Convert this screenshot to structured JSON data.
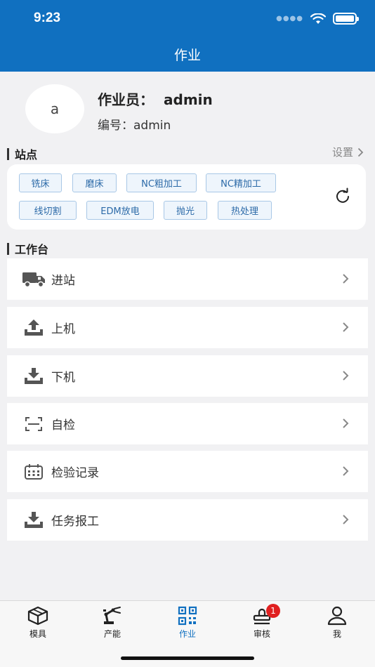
{
  "status_bar": {
    "time": "9:23"
  },
  "nav": {
    "title": "作业"
  },
  "profile": {
    "avatar_letter": "a",
    "operator_label": "作业员：",
    "operator_value": "admin",
    "id_label": "编号：",
    "id_value": "admin"
  },
  "stations": {
    "title": "站点",
    "settings_label": "设置",
    "tags": [
      "铣床",
      "磨床",
      "NC粗加工",
      "NC精加工",
      "线切割",
      "EDM放电",
      "抛光",
      "热处理"
    ]
  },
  "workbench": {
    "title": "工作台",
    "items": [
      {
        "label": "进站",
        "icon": "truck-icon"
      },
      {
        "label": "上机",
        "icon": "upload-icon"
      },
      {
        "label": "下机",
        "icon": "download-icon"
      },
      {
        "label": "自检",
        "icon": "scan-icon"
      },
      {
        "label": "检验记录",
        "icon": "calendar-icon"
      },
      {
        "label": "任务报工",
        "icon": "download-tray-icon"
      }
    ]
  },
  "tabbar": {
    "tabs": [
      {
        "label": "模具",
        "icon": "cube-icon"
      },
      {
        "label": "产能",
        "icon": "robot-arm-icon"
      },
      {
        "label": "作业",
        "icon": "qrcode-icon",
        "active": true
      },
      {
        "label": "审核",
        "icon": "stamp-icon",
        "badge": "1"
      },
      {
        "label": "我",
        "icon": "user-icon"
      }
    ]
  },
  "colors": {
    "primary": "#1070c0",
    "badge": "#e02020",
    "tag_border": "#a8c7e6"
  }
}
